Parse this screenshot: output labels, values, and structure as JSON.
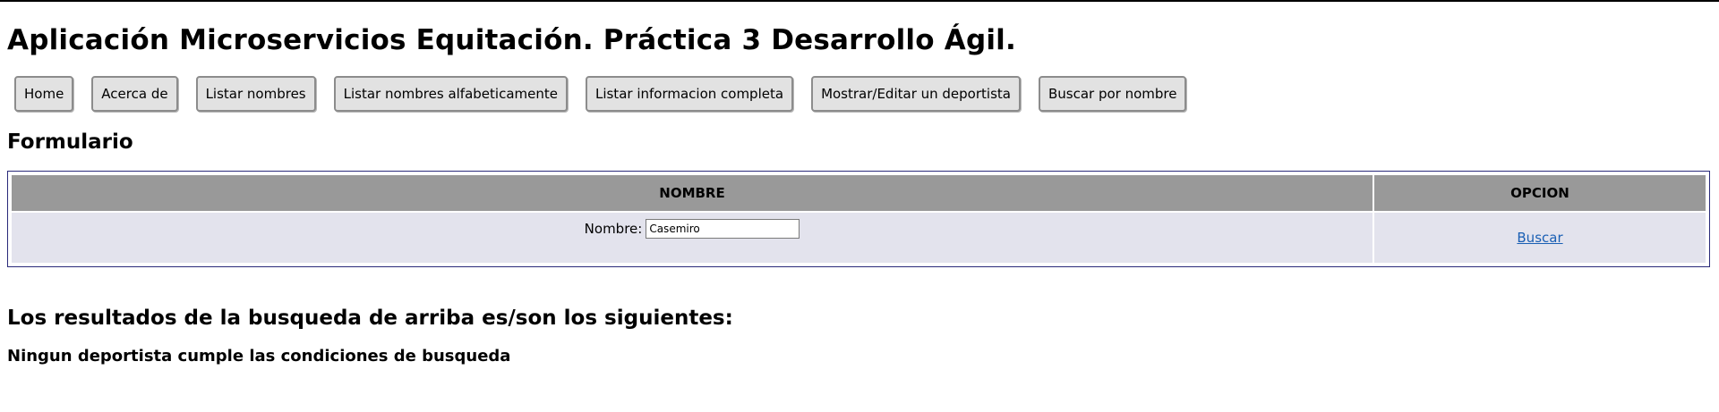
{
  "app": {
    "title": "Aplicación Microservicios Equitación. Práctica 3 Desarrollo Ágil."
  },
  "nav": {
    "items": [
      {
        "label": "Home"
      },
      {
        "label": "Acerca de"
      },
      {
        "label": "Listar nombres"
      },
      {
        "label": "Listar nombres alfabeticamente"
      },
      {
        "label": "Listar informacion completa"
      },
      {
        "label": "Mostrar/Editar un deportista"
      },
      {
        "label": "Buscar por nombre"
      }
    ]
  },
  "form": {
    "title": "Formulario",
    "headers": {
      "nombre": "NOMBRE",
      "opcion": "OPCION"
    },
    "name_label": "Nombre:",
    "name_value": "Casemiro",
    "search_link": "Buscar"
  },
  "results": {
    "title": "Los resultados de la busqueda de arriba es/son los siguientes:",
    "message": "Ningun deportista cumple las condiciones de busqueda"
  }
}
